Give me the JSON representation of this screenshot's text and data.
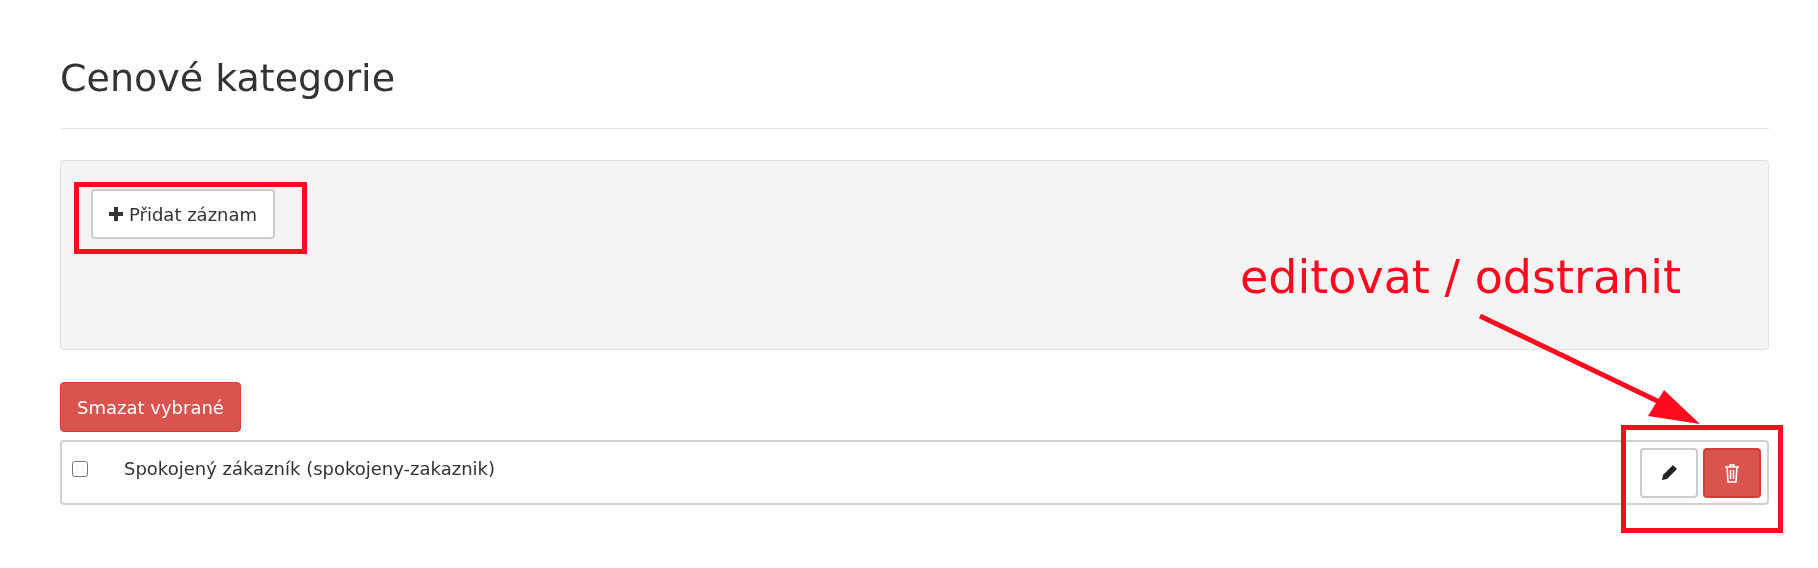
{
  "page": {
    "title": "Cenové kategorie"
  },
  "toolbar": {
    "add_button": "Přidat záznam"
  },
  "bulk_delete_button": "Smazat vybrané",
  "rows": [
    {
      "label": "Spokojený zákazník (spokojeny-zakaznik)",
      "checked": false
    }
  ],
  "annotation": {
    "label": "editovat / odstranit"
  }
}
